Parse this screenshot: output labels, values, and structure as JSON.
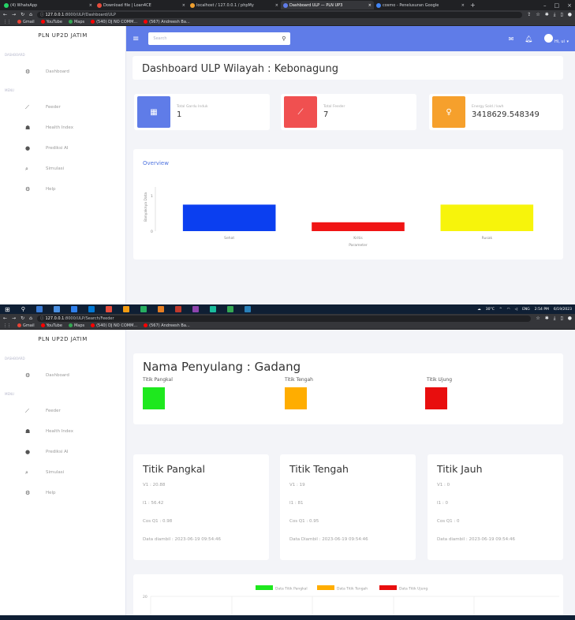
{
  "browser": {
    "tabs": [
      {
        "label": "(4) WhatsApp",
        "fav": "#25d366"
      },
      {
        "label": "Download file | Loan4CE",
        "fav": "#e74c3c"
      },
      {
        "label": "localhost / 127.0.0.1 / phpMy",
        "fav": "#f0a030"
      },
      {
        "label": "Dashboard ULP — PLN UP3",
        "fav": "#5f7ce8",
        "active": true
      },
      {
        "label": "cosmo - Penelusuran Google",
        "fav": "#4285f4"
      }
    ],
    "url1_host": "127.0.0.1",
    "url1_path": ":8000/ULP/Dashboard/ULP",
    "url2_host": "127.0.0.1",
    "url2_path": ":8000/ULP/Search/Feeder",
    "bookmarks": [
      {
        "label": "Gmail",
        "color": "#ea4335"
      },
      {
        "label": "YouTube",
        "color": "#ff0000"
      },
      {
        "label": "Maps",
        "color": "#34a853"
      },
      {
        "label": "(540) DJ NO COMM...",
        "color": "#ff0000"
      },
      {
        "label": "(567) Andreesh Ba...",
        "color": "#ff0000"
      }
    ]
  },
  "sidebar": {
    "brand": "PLN UP2D JATIM",
    "sec_dashboard": "DASHBOARD",
    "sec_menu": "MENU",
    "dashboard": "Dashboard",
    "items": [
      "Feeder",
      "Health Index",
      "Prediksi AI",
      "Simulasi",
      "Help"
    ]
  },
  "topbar": {
    "search_placeholder": "Search",
    "user": "Hi, ui"
  },
  "dashboard": {
    "title": "Dashboard ULP Wilayah : Kebonagung",
    "stats": [
      {
        "label": "Total Gardu Induk",
        "value": "1",
        "color": "#5f7ce8"
      },
      {
        "label": "Total Feeder",
        "value": "7",
        "color": "#f05050"
      },
      {
        "label": "Energy Sold / kwh",
        "value": "3418629.548349",
        "color": "#f6a02c"
      }
    ],
    "overview_title": "Overview"
  },
  "chart_data": {
    "type": "bar",
    "categories": [
      "Sehat",
      "Kritis",
      "Rusak"
    ],
    "values": [
      3,
      1,
      3
    ],
    "colors": [
      "#0b3ff0",
      "#f01414",
      "#f7f40b"
    ],
    "ylabel": "Banyaknya Data",
    "xlabel": "Parameter",
    "yticks": [
      "1",
      "0"
    ],
    "ylim": [
      0,
      5
    ],
    "grid": false
  },
  "feeder": {
    "title": "Nama Penyulang : Gadang",
    "lamps": [
      {
        "label": "Titik Pangkal",
        "color": "#1ee81e"
      },
      {
        "label": "Titik Tengah",
        "color": "#ffad00"
      },
      {
        "label": "Titik Ujung",
        "color": "#e80e0e"
      }
    ],
    "points": [
      {
        "title": "Titik Pangkal",
        "v": "V1 : 20.88",
        "i": "I1 : 56.42",
        "cos": "Cos Q1 : 0.98",
        "date": "Data diambil : 2023-06-19 09:54:46"
      },
      {
        "title": "Titik Tengah",
        "v": "V1 : 19",
        "i": "I1 : 81",
        "cos": "Cos Q1 : 0.95",
        "date": "Data Diambil : 2023-06-19 09:54:46"
      },
      {
        "title": "Titik Jauh",
        "v": "V1 : 0",
        "i": "I1 : 0",
        "cos": "Cos Q1 : 0",
        "date": "Data diambil : 2023-06-19 09:54:46"
      }
    ],
    "legend": [
      {
        "label": "Data Titik Pangkal",
        "color": "#1ee81e"
      },
      {
        "label": "Data Titik Tengah",
        "color": "#ffad00"
      },
      {
        "label": "Data Titik Ujung",
        "color": "#e80e0e"
      }
    ],
    "ytick": "20"
  },
  "taskbar": {
    "temp": "30°C",
    "lang": "ENG",
    "time": "2:54 PM",
    "date": "6/19/2023"
  }
}
